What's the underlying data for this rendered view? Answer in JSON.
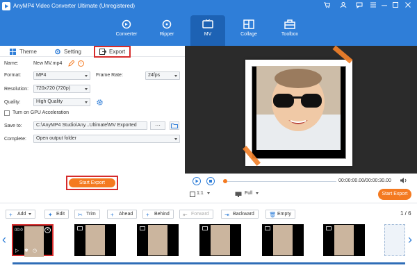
{
  "app": {
    "title": "AnyMP4 Video Converter Ultimate (Unregistered)"
  },
  "nav": [
    {
      "label": "Converter"
    },
    {
      "label": "Ripper"
    },
    {
      "label": "MV"
    },
    {
      "label": "Collage"
    },
    {
      "label": "Toolbox"
    }
  ],
  "tabs": {
    "theme": "Theme",
    "setting": "Setting",
    "export": "Export"
  },
  "form": {
    "name_label": "Name:",
    "name_value": "New MV.mp4",
    "format_label": "Format:",
    "format_value": "MP4",
    "framerate_label": "Frame Rate:",
    "framerate_value": "24fps",
    "resolution_label": "Resolution:",
    "resolution_value": "720x720 (720p)",
    "quality_label": "Quality:",
    "quality_value": "High Quality",
    "gpu_label": "Turn on GPU Acceleration",
    "saveto_label": "Save to:",
    "saveto_value": "C:\\AnyMP4 Studio\\Any...Ultimate\\MV Exported",
    "dots": "···",
    "complete_label": "Complete:",
    "complete_value": "Open output folder",
    "export_button": "Start Export"
  },
  "player": {
    "time": "00:00:00.00/00:00:30.00",
    "ratio": "1:1",
    "fit": "Full",
    "export_button": "Start Export"
  },
  "toolbar": {
    "add": "Add",
    "edit": "Edit",
    "trim": "Trim",
    "ahead": "Ahead",
    "behind": "Behind",
    "forward": "Forward",
    "backward": "Backward",
    "empty": "Empty",
    "page": "1 / 6"
  },
  "timeline": {
    "first_clip_time": "00:0"
  },
  "colors": {
    "brand": "#2f7ed8",
    "accent": "#f47a20",
    "highlight": "#d62b2b"
  }
}
